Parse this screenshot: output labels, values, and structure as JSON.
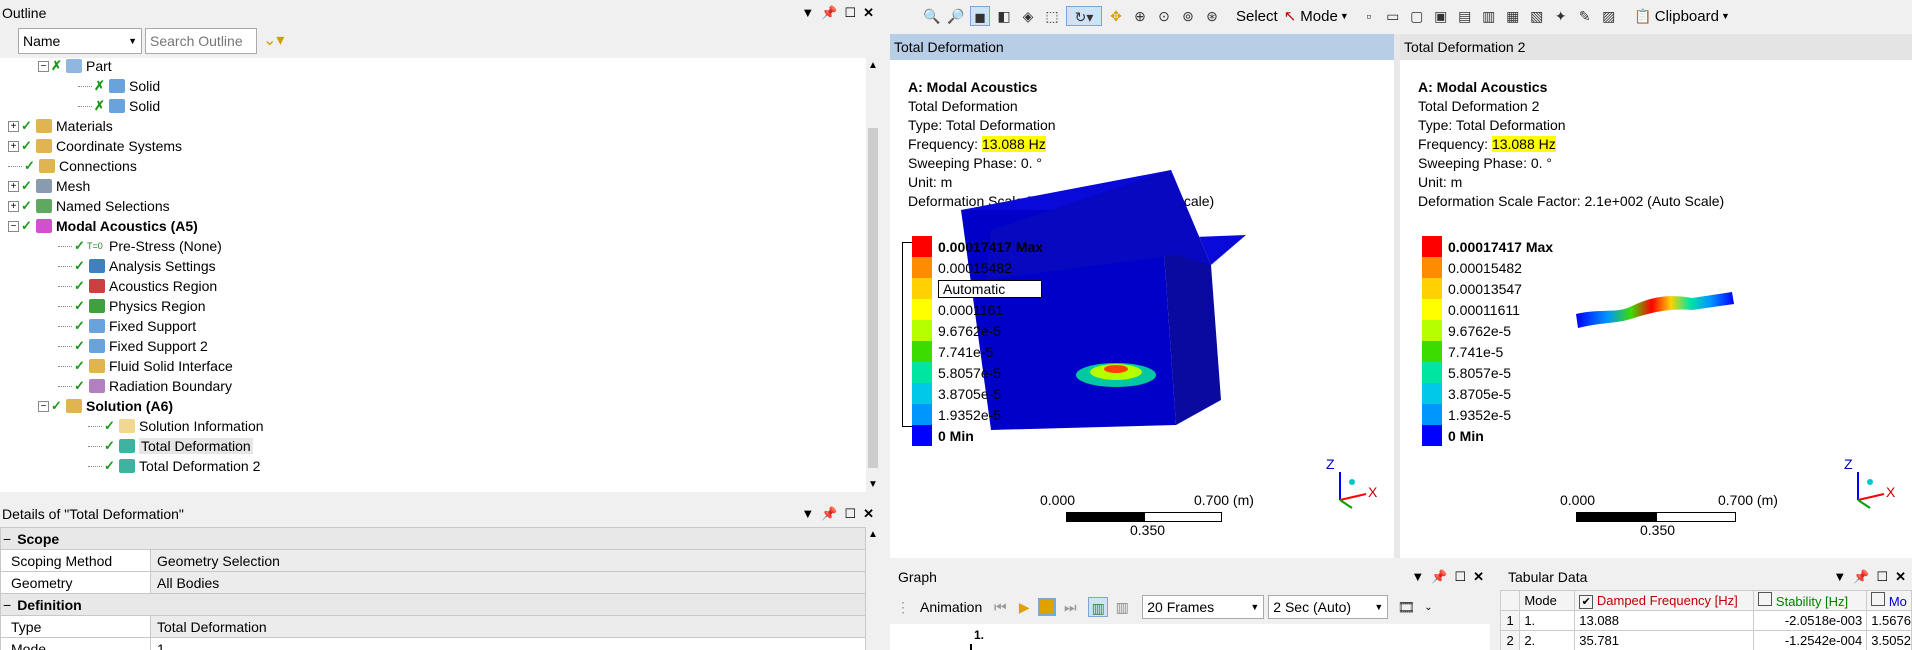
{
  "outline": {
    "title": "Outline",
    "filter_value": "Name",
    "search_placeholder": "Search Outline",
    "items": [
      {
        "label": "Part",
        "bold": false
      },
      {
        "label": "Solid",
        "bold": false
      },
      {
        "label": "Solid",
        "bold": false
      },
      {
        "label": "Materials",
        "bold": false
      },
      {
        "label": "Coordinate Systems",
        "bold": false
      },
      {
        "label": "Connections",
        "bold": false
      },
      {
        "label": "Mesh",
        "bold": false
      },
      {
        "label": "Named Selections",
        "bold": false
      },
      {
        "label": "Modal Acoustics (A5)",
        "bold": true
      },
      {
        "label": "Pre-Stress (None)",
        "bold": false
      },
      {
        "label": "Analysis Settings",
        "bold": false
      },
      {
        "label": "Acoustics Region",
        "bold": false
      },
      {
        "label": "Physics Region",
        "bold": false
      },
      {
        "label": "Fixed Support",
        "bold": false
      },
      {
        "label": "Fixed Support 2",
        "bold": false
      },
      {
        "label": "Fluid Solid Interface",
        "bold": false
      },
      {
        "label": "Radiation Boundary",
        "bold": false
      },
      {
        "label": "Solution (A6)",
        "bold": true
      },
      {
        "label": "Solution Information",
        "bold": false
      },
      {
        "label": "Total Deformation",
        "bold": false
      },
      {
        "label": "Total Deformation 2",
        "bold": false
      }
    ],
    "tse_label": "T=0"
  },
  "details": {
    "title": "Details of \"Total Deformation\"",
    "rows": [
      {
        "section": true,
        "key": "Scope",
        "value": ""
      },
      {
        "section": false,
        "key": "Scoping Method",
        "value": "Geometry Selection"
      },
      {
        "section": false,
        "key": "Geometry",
        "value": "All Bodies"
      },
      {
        "section": true,
        "key": "Definition",
        "value": ""
      },
      {
        "section": false,
        "key": "Type",
        "value": "Total Deformation"
      },
      {
        "section": false,
        "key": "Mode",
        "value": "1."
      }
    ]
  },
  "toolbar": {
    "select_label": "Select",
    "mode_label": "Mode",
    "clipboard_label": "Clipboard"
  },
  "view1": {
    "tab": "Total Deformation",
    "info": {
      "title": "A: Modal Acoustics",
      "name": "Total Deformation",
      "type": "Type: Total Deformation",
      "freq_label": "Frequency: ",
      "freq_value": "13.088 Hz",
      "phase": "Sweeping Phase: 0. °",
      "unit": "Unit: m",
      "scale": "Deformation Scale Factor: 1.7e+002 (Auto Scale)"
    },
    "legend": [
      "0.00017417 Max",
      "0.00015482",
      "Automatic",
      "0.0001161",
      "9.6762e-5",
      "7.741e-5",
      "5.8057e-5",
      "3.8705e-5",
      "1.9352e-5",
      "0 Min"
    ],
    "scale": {
      "left": "0.000",
      "right": "0.700 (m)",
      "mid": "0.350"
    },
    "axes": {
      "z": "Z",
      "x": "X"
    }
  },
  "view2": {
    "tab": "Total Deformation 2",
    "info": {
      "title": "A: Modal Acoustics",
      "name": "Total Deformation 2",
      "type": "Type: Total Deformation",
      "freq_label": "Frequency: ",
      "freq_value": "13.088 Hz",
      "phase": "Sweeping Phase: 0. °",
      "unit": "Unit: m",
      "scale": "Deformation Scale Factor: 2.1e+002 (Auto Scale)"
    },
    "legend": [
      "0.00017417 Max",
      "0.00015482",
      "0.00013547",
      "0.00011611",
      "9.6762e-5",
      "7.741e-5",
      "5.8057e-5",
      "3.8705e-5",
      "1.9352e-5",
      "0 Min"
    ],
    "scale": {
      "left": "0.000",
      "right": "0.700 (m)",
      "mid": "0.350"
    },
    "axes": {
      "z": "Z",
      "x": "X"
    }
  },
  "legend_colors": [
    "#ff0000",
    "#ff8c00",
    "#ffd200",
    "#ffff00",
    "#b4ff00",
    "#3cdc00",
    "#00e6a0",
    "#00c8e6",
    "#0096ff",
    "#0000ff"
  ],
  "graph": {
    "title": "Graph",
    "animation_label": "Animation",
    "frames": "20 Frames",
    "duration": "2 Sec (Auto)",
    "y_tick": "1."
  },
  "tabular": {
    "title": "Tabular Data",
    "col_mode": "Mode",
    "col_freq": "Damped Frequency [Hz]",
    "col_stab": "Stability [Hz]",
    "col_mod": "Mo",
    "rows": [
      {
        "idx": "1",
        "mode": "1.",
        "freq": "13.088",
        "stab": "-2.0518e-003",
        "mod": "1.5676"
      },
      {
        "idx": "2",
        "mode": "2.",
        "freq": "35.781",
        "stab": "-1.2542e-004",
        "mod": "3.5052"
      }
    ]
  }
}
